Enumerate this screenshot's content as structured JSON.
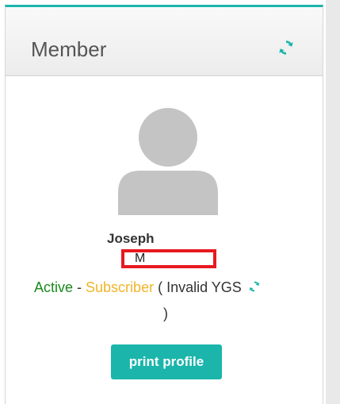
{
  "card": {
    "title": "Member",
    "refresh_icon": "refresh-icon",
    "accent_color": "#1bb5ab"
  },
  "profile": {
    "avatar_icon": "user-silhouette-icon",
    "name": "Joseph",
    "surname_initial": "M",
    "status": {
      "active": "Active",
      "separator": " - ",
      "type": "Subscriber",
      "note_open": " ( Invalid YGS",
      "note_close": ")",
      "active_color": "#1a8a1a",
      "type_color": "#f0b429"
    }
  },
  "actions": {
    "print_label": "print profile"
  }
}
